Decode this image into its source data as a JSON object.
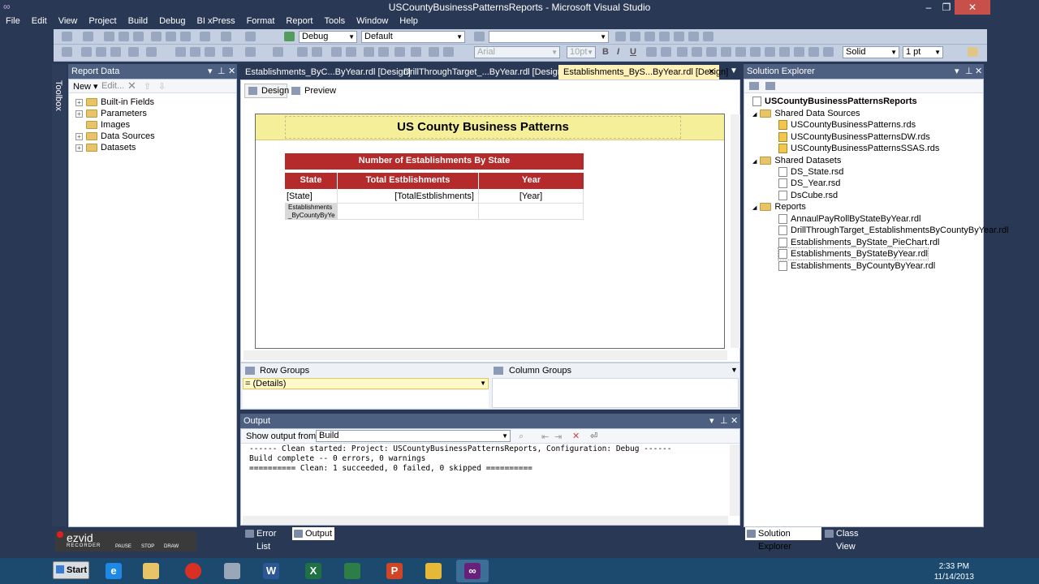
{
  "window": {
    "title": "USCountyBusinessPatternsReports - Microsoft Visual Studio",
    "controls": {
      "minimize": "–",
      "maximize": "❐",
      "close": "✕"
    }
  },
  "menu": [
    "File",
    "Edit",
    "View",
    "Project",
    "Build",
    "Debug",
    "BI xPress",
    "Format",
    "Report",
    "Tools",
    "Window",
    "Help"
  ],
  "toolbar1": {
    "configuration": "Debug",
    "platform": "Default"
  },
  "toolbar2": {
    "font": "Arial",
    "font_size": "10pt",
    "bold": "B",
    "italic": "I",
    "underline": "U",
    "border_style": "Solid",
    "border_width": "1 pt"
  },
  "toolbox_strip": {
    "label": "Toolbox"
  },
  "report_data": {
    "title": "Report Data",
    "new_label": "New ▾",
    "edit_label": "Edit...",
    "items": [
      "Built-in Fields",
      "Parameters",
      "Images",
      "Data Sources",
      "Datasets"
    ]
  },
  "doc_tabs": [
    {
      "label": "Establishments_ByC...ByYear.rdl [Design]"
    },
    {
      "label": "DrillThroughTarget_...ByYear.rdl [Design]"
    },
    {
      "label": "Establishments_ByS...ByYear.rdl [Design]"
    }
  ],
  "view_tabs": {
    "design": "Design",
    "preview": "Preview"
  },
  "report": {
    "title": "US County Business Patterns",
    "table_title": "Number of Establishments By State",
    "headers": [
      "State",
      "Total Estblishments",
      "Year"
    ],
    "row": [
      "[State]",
      "[TotalEstblishments]",
      "[Year]"
    ],
    "footer_cell_line1": "Establishments",
    "footer_cell_line2": "_ByCountyByYe"
  },
  "groups": {
    "row_label": "Row Groups",
    "column_label": "Column Groups",
    "details": "= (Details)"
  },
  "output": {
    "title": "Output",
    "show_from_label": "Show output from:",
    "source": "Build",
    "lines": [
      "------ Clean started: Project: USCountyBusinessPatternsReports, Configuration: Debug ------",
      "Build complete -- 0 errors, 0 warnings",
      "========== Clean: 1 succeeded, 0 failed, 0 skipped =========="
    ]
  },
  "bottom_tabs": {
    "error_list": "Error List",
    "output": "Output",
    "solution_explorer": "Solution Explorer",
    "class_view": "Class View"
  },
  "solution_explorer": {
    "title": "Solution Explorer",
    "project": "USCountyBusinessPatternsReports",
    "shared_data_sources": {
      "label": "Shared Data Sources",
      "items": [
        "USCountyBusinessPatterns.rds",
        "USCountyBusinessPatternsDW.rds",
        "USCountyBusinessPatternsSSAS.rds"
      ]
    },
    "shared_datasets": {
      "label": "Shared Datasets",
      "items": [
        "DS_State.rsd",
        "DS_Year.rsd",
        "DsCube.rsd"
      ]
    },
    "reports": {
      "label": "Reports",
      "items": [
        "AnnaulPayRollByStateByYear.rdl",
        "DrillThroughTarget_EstablishmentsByCountyByYear.rdl",
        "Establishments_ByState_PieChart.rdl",
        "Establishments_ByStateByYear.rdl",
        "Establishments_ByCountyByYear.rdl"
      ]
    }
  },
  "ezvid": {
    "brand": "ezvid",
    "sub": "RECORDER",
    "pause": "PAUSE",
    "stop": "STOP",
    "draw": "DRAW"
  },
  "taskbar": {
    "start": "Start",
    "time": "2:33 PM",
    "date": "11/14/2013"
  }
}
